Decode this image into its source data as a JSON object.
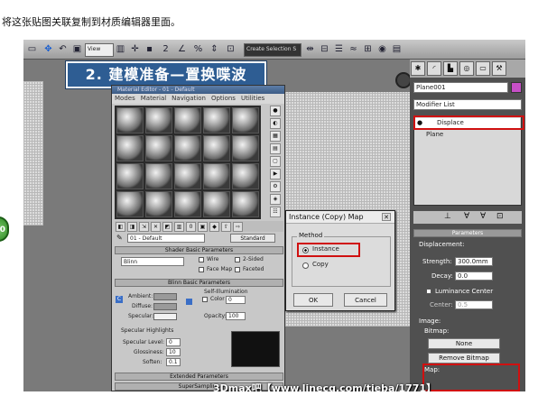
{
  "caption": "将这张贴图关联复制到材质编辑器里面。",
  "banner": "2. 建模准备—置换喋波",
  "watermark": "3Dmax吧【www.linecg.com/tieba/1771】",
  "badge": "0",
  "toolbar": {
    "view_label": "View",
    "selection_set": "Create Selection S"
  },
  "material_editor": {
    "title": "Material Editor - 01 - Default",
    "menus": [
      "Modes",
      "Material",
      "Navigation",
      "Options",
      "Utilities"
    ],
    "material_name": "01 - Default",
    "material_type": "Standard",
    "shader_rollout": "Shader Basic Parameters",
    "shader": "Blinn",
    "shader_options": [
      "Wire",
      "2-Sided",
      "Face Map",
      "Faceted"
    ],
    "blinn_rollout": "Blinn Basic Parameters",
    "self_illum": "Self-Illumination",
    "color_label": "Color",
    "color_value": "0",
    "ambient": "Ambient:",
    "diffuse": "Diffuse:",
    "specular": "Specular:",
    "opacity_label": "Opacity:",
    "opacity_value": "100",
    "spec_highlights": "Specular Highlights",
    "specular_level": "Specular Level:",
    "specular_level_value": "0",
    "glossiness": "Glossiness:",
    "glossiness_value": "10",
    "soften": "Soften:",
    "soften_value": "0.1",
    "extended_rollout": "Extended Parameters",
    "supersampling": "SuperSampling"
  },
  "dialog": {
    "title": "Instance (Copy) Map",
    "method": "Method",
    "option_instance": "Instance",
    "option_copy": "Copy",
    "selected": "Instance",
    "ok": "OK",
    "cancel": "Cancel"
  },
  "command_panel": {
    "object_name": "Plane001",
    "modifier_list": "Modifier List",
    "stack": [
      "Displace",
      "Plane"
    ],
    "parameters_rollout": "Parameters",
    "displacement": "Displacement:",
    "strength_label": "Strength:",
    "strength_value": "300.0mm",
    "decay_label": "Decay:",
    "decay_value": "0.0",
    "luminance_center": "Luminance Center",
    "center_label": "Center:",
    "center_value": "0.5",
    "image": "Image:",
    "bitmap": "Bitmap:",
    "bitmap_button": "None",
    "remove_bitmap": "Remove Bitmap",
    "map": "Map:"
  },
  "colors": {
    "banner": "#2e5d93",
    "highlight": "#d01010",
    "object_color": "#c64fc6"
  }
}
